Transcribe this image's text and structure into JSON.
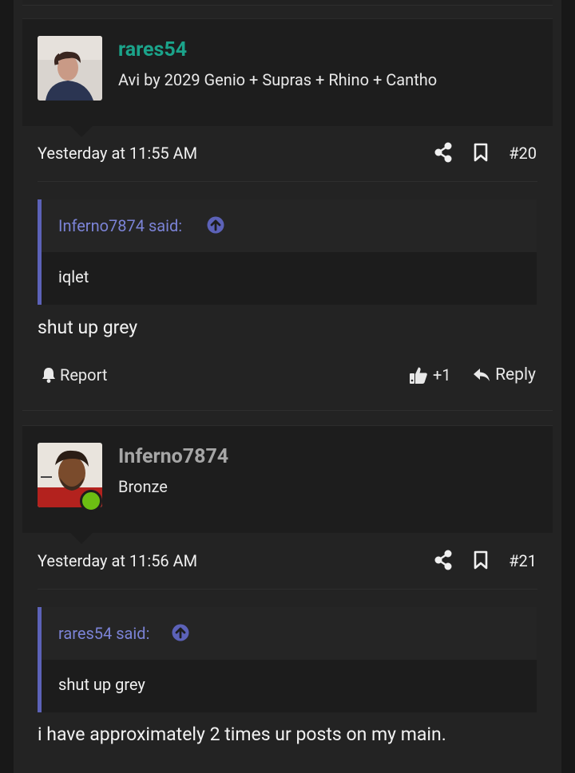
{
  "posts": [
    {
      "username": "rares54",
      "username_color": "#1ba38a",
      "user_title": "Avi by 2029 Genio + Supras + Rhino + Cantho",
      "date": "Yesterday at 11:55 AM",
      "post_number": "#20",
      "quote_author": "Inferno7874 said:",
      "quote_text": "iqlet",
      "message": "shut up grey",
      "actions": {
        "report": "Report",
        "like_count": "+1",
        "reply": "Reply"
      }
    },
    {
      "username": "Inferno7874",
      "username_color": "#a6a6a6",
      "user_title": "Bronze",
      "online": true,
      "date": "Yesterday at 11:56 AM",
      "post_number": "#21",
      "quote_author": "rares54 said:",
      "quote_text": "shut up grey",
      "message": "i have approximately 2 times ur posts on my main."
    }
  ],
  "colors": {
    "accent_quote": "#5c62b8",
    "quote_author": "#7b83d6",
    "online": "#6cbe13"
  }
}
